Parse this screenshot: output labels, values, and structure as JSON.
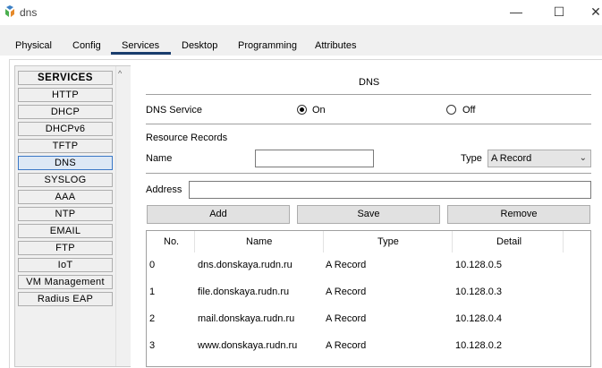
{
  "window": {
    "title": "dns",
    "min_label": "—",
    "max_label": "☐",
    "close_label": "✕"
  },
  "tabs": [
    {
      "label": "Physical"
    },
    {
      "label": "Config"
    },
    {
      "label": "Services"
    },
    {
      "label": "Desktop"
    },
    {
      "label": "Programming"
    },
    {
      "label": "Attributes"
    }
  ],
  "sidebar": {
    "header": "SERVICES",
    "items": [
      {
        "label": "HTTP"
      },
      {
        "label": "DHCP"
      },
      {
        "label": "DHCPv6"
      },
      {
        "label": "TFTP"
      },
      {
        "label": "DNS"
      },
      {
        "label": "SYSLOG"
      },
      {
        "label": "AAA"
      },
      {
        "label": "NTP"
      },
      {
        "label": "EMAIL"
      },
      {
        "label": "FTP"
      },
      {
        "label": "IoT"
      },
      {
        "label": "VM Management"
      },
      {
        "label": "Radius EAP"
      }
    ],
    "active": "DNS",
    "scroll_up": "^"
  },
  "dns": {
    "title": "DNS",
    "service_label": "DNS Service",
    "on_label": "On",
    "off_label": "Off",
    "service_state": "on",
    "records_label": "Resource Records",
    "name_label": "Name",
    "name_value": "",
    "type_label": "Type",
    "type_value": "A Record",
    "address_label": "Address",
    "address_value": "",
    "add_label": "Add",
    "save_label": "Save",
    "remove_label": "Remove"
  },
  "table": {
    "columns": [
      "No.",
      "Name",
      "Type",
      "Detail"
    ],
    "rows": [
      {
        "no": "0",
        "name": "dns.donskaya.rudn.ru",
        "type": "A Record",
        "detail": "10.128.0.5"
      },
      {
        "no": "1",
        "name": "file.donskaya.rudn.ru",
        "type": "A Record",
        "detail": "10.128.0.3"
      },
      {
        "no": "2",
        "name": "mail.donskaya.rudn.ru",
        "type": "A Record",
        "detail": "10.128.0.4"
      },
      {
        "no": "3",
        "name": "www.donskaya.rudn.ru",
        "type": "A Record",
        "detail": "10.128.0.2"
      }
    ]
  }
}
